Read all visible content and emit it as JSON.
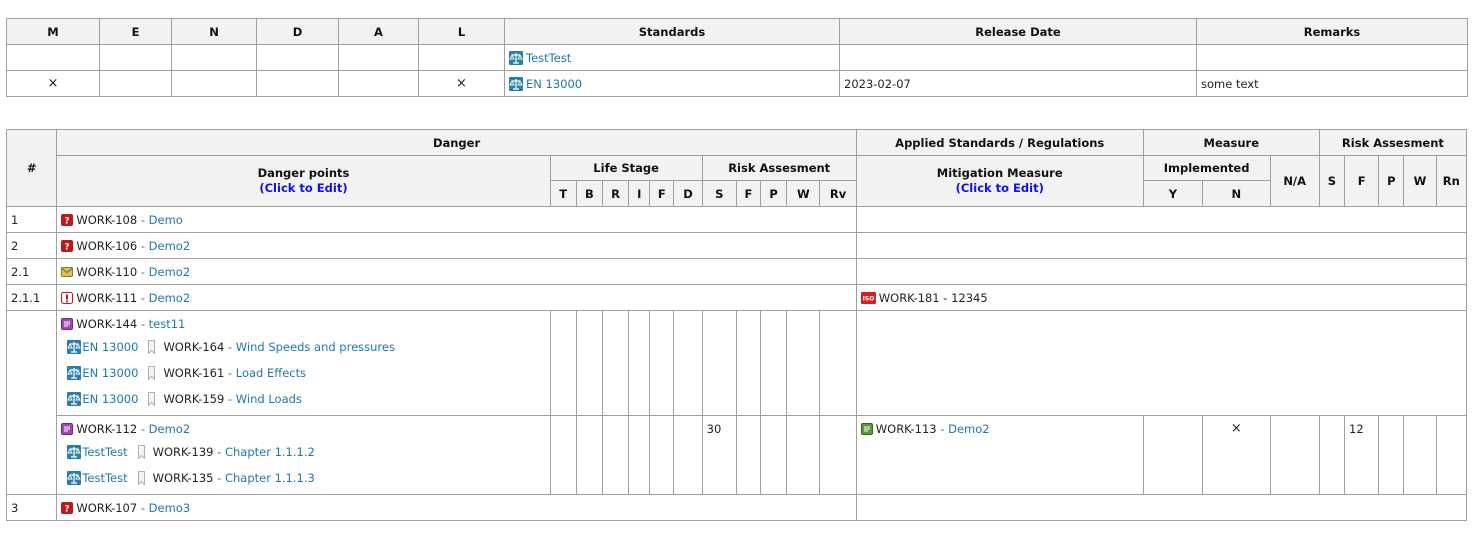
{
  "standards_table": {
    "headers": [
      "M",
      "E",
      "N",
      "D",
      "A",
      "L",
      "Standards",
      "Release Date",
      "Remarks"
    ],
    "rows": [
      {
        "marks": [
          "",
          "",
          "",
          "",
          "",
          ""
        ],
        "standard": "TestTest",
        "release_date": "",
        "remarks": ""
      },
      {
        "marks": [
          "×",
          "",
          "",
          "",
          "",
          "×"
        ],
        "standard": "EN 13000",
        "release_date": "2023-02-07",
        "remarks": "some text"
      }
    ]
  },
  "risk_table": {
    "headers": {
      "num": "#",
      "danger": "Danger",
      "danger_points": "Danger points",
      "click_to_edit": "(Click to Edit)",
      "life_stage": "Life Stage",
      "life_cols": [
        "T",
        "B",
        "R",
        "I",
        "F",
        "D"
      ],
      "risk_assessment": "Risk Assesment",
      "risk_cols": [
        "S",
        "F",
        "P",
        "W",
        "Rv"
      ],
      "applied_standards": "Applied Standards / Regulations",
      "mitigation_measure": "Mitigation Measure",
      "measure": "Measure",
      "implemented": "Implemented",
      "impl_cols": [
        "Y",
        "N"
      ],
      "na": "N/A",
      "risk_assessment2": "Risk Assesment",
      "risk2_cols": [
        "S",
        "F",
        "P",
        "W",
        "Rn"
      ]
    },
    "rows": [
      {
        "num": "1",
        "id": "WORK-108",
        "title": "Demo"
      },
      {
        "num": "2",
        "id": "WORK-106",
        "title": "Demo2"
      },
      {
        "num": "2.1",
        "id": "WORK-110",
        "title": "Demo2"
      },
      {
        "num": "2.1.1",
        "id": "WORK-111",
        "title": "Demo2",
        "mitigation": "WORK-181 - 12345"
      },
      {
        "num": "",
        "id": "WORK-144",
        "title": "test11",
        "refs": [
          {
            "standard": "EN 13000",
            "id": "WORK-164",
            "title": "Wind Speeds and pressures"
          },
          {
            "standard": "EN 13000",
            "id": "WORK-161",
            "title": "Load Effects"
          },
          {
            "standard": "EN 13000",
            "id": "WORK-159",
            "title": "Wind Loads"
          }
        ]
      },
      {
        "num": "",
        "id": "WORK-112",
        "title": "Demo2",
        "risk_s": "30",
        "measure_id": "WORK-113",
        "measure_title": "Demo2",
        "impl_n": "×",
        "risk2_f": "12",
        "refs": [
          {
            "standard": "TestTest",
            "id": "WORK-139",
            "title": "Chapter 1.1.1.2"
          },
          {
            "standard": "TestTest",
            "id": "WORK-135",
            "title": "Chapter 1.1.1.3"
          }
        ]
      },
      {
        "num": "3",
        "id": "WORK-107",
        "title": "Demo3"
      }
    ],
    "separator": " - "
  },
  "colors": {
    "link": "#1f78a8",
    "edit_link": "#1010ee",
    "header_bg": "#f2f2f2",
    "border": "#a0a0a0"
  },
  "icons": {
    "standard": "scales-icon",
    "bug": "red-question-icon",
    "task": "yellow-envelope-icon",
    "warning": "red-exclamation-icon",
    "iso": "iso-badge-icon",
    "story": "purple-doc-icon",
    "green": "green-doc-icon",
    "bookmark": "bookmark-icon"
  }
}
